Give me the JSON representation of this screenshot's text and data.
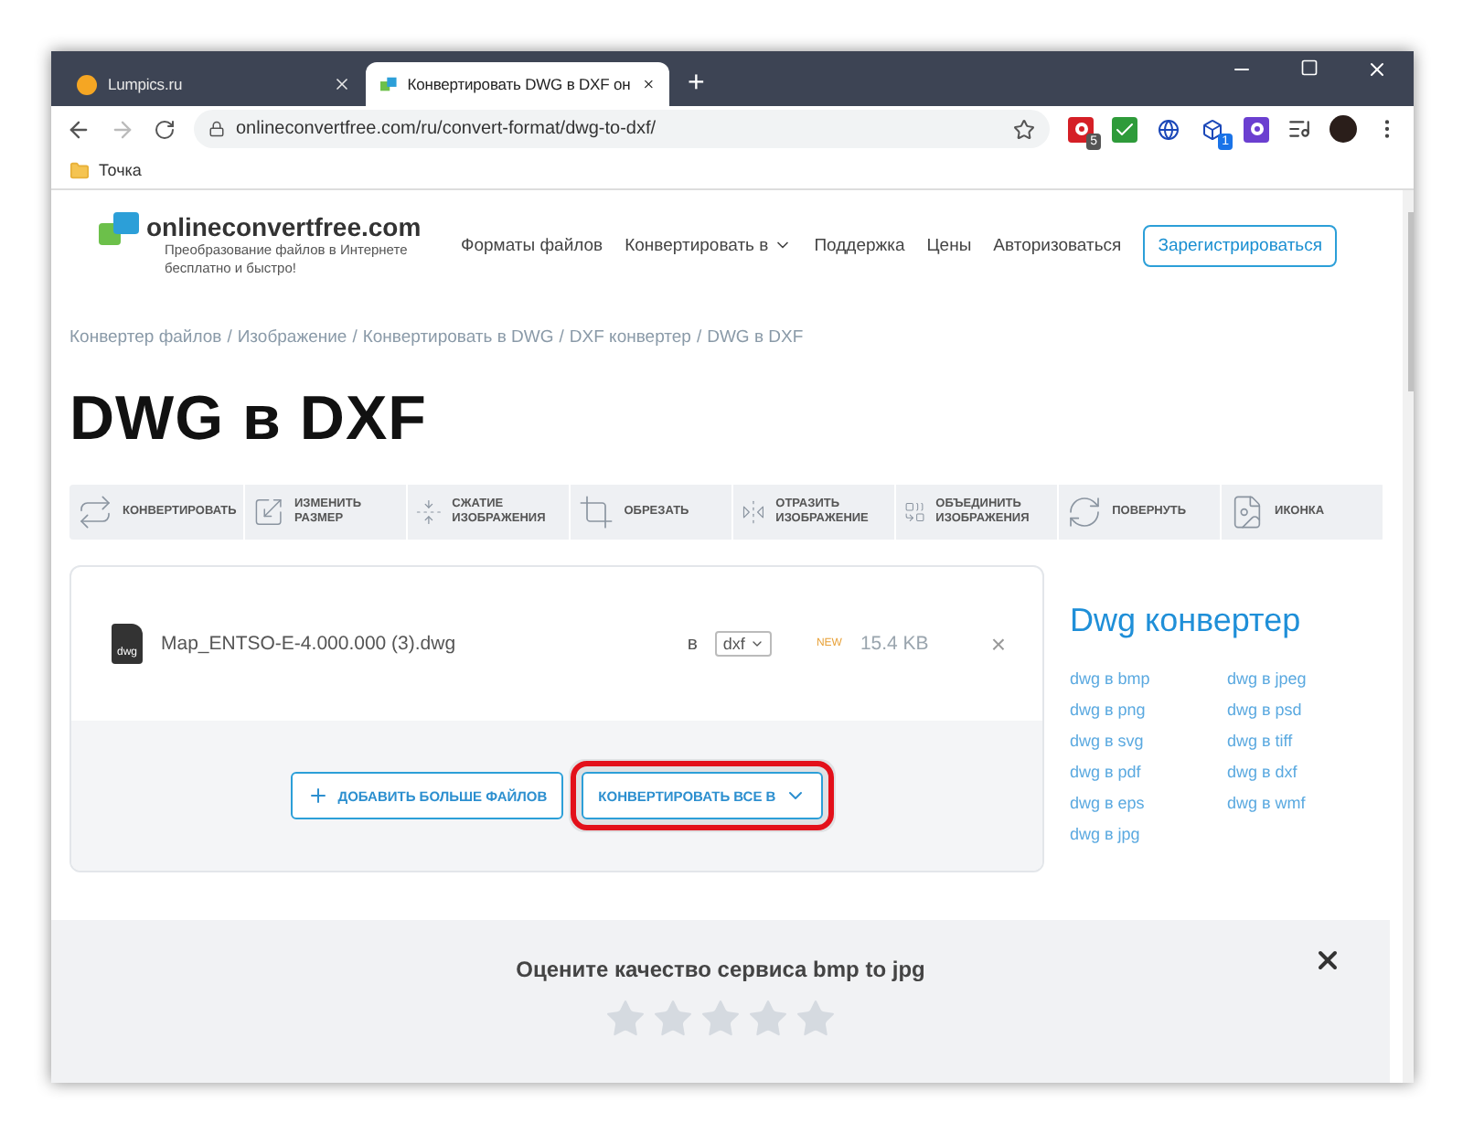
{
  "browser": {
    "tabs": [
      {
        "title": "Lumpics.ru",
        "selected": false
      },
      {
        "title": "Конвертировать DWG в DXF он",
        "selected": true
      }
    ],
    "new_tab": "+",
    "address": "onlineconvertfree.com/ru/convert-format/dwg-to-dxf/",
    "extensions": [
      {
        "kind": "opera",
        "badge": "5"
      },
      {
        "kind": "check"
      },
      {
        "kind": "globe"
      },
      {
        "kind": "cube",
        "badge": "1"
      },
      {
        "kind": "ao"
      }
    ],
    "bookmarks": [
      {
        "label": "Точка"
      }
    ]
  },
  "site": {
    "logo": "onlineconvertfree.com",
    "tagline": "Преобразование файлов в Интернете бесплатно и быстро!",
    "nav": [
      {
        "label": "Форматы файлов",
        "dropdown": false
      },
      {
        "label": "Конвертировать в",
        "dropdown": true
      },
      {
        "label": "Поддержка",
        "dropdown": false
      },
      {
        "label": "Цены",
        "dropdown": false
      },
      {
        "label": "Авторизоваться",
        "dropdown": false
      }
    ],
    "signup": "Зарегистрироваться"
  },
  "breadcrumb": [
    "Конвертер файлов",
    "Изображение",
    "Конвертировать в DWG",
    "DXF конвертер",
    "DWG в DXF"
  ],
  "breadcrumb_separator": "/",
  "heading": "DWG в DXF",
  "tools": [
    {
      "kind": "convert",
      "label": "КОНВЕРТИРОВАТЬ"
    },
    {
      "kind": "resize",
      "label": "ИЗМЕНИТЬ РАЗМЕР"
    },
    {
      "kind": "compress",
      "label": "СЖАТИЕ ИЗОБРАЖЕНИЯ"
    },
    {
      "kind": "crop",
      "label": "ОБРЕЗАТЬ"
    },
    {
      "kind": "flip",
      "label": "ОТРАЗИТЬ ИЗОБРАЖЕНИЕ"
    },
    {
      "kind": "merge",
      "label": "ОБЪЕДИНИТЬ ИЗОБРАЖЕНИЯ"
    },
    {
      "kind": "rotate",
      "label": "ПОВЕРНУТЬ"
    },
    {
      "kind": "icon",
      "label": "ИКОНКА"
    }
  ],
  "file": {
    "badge": "dwg",
    "name": "Map_ENTSO-E-4.000.000 (3).dwg",
    "to": "в",
    "format": "dxf",
    "new": "NEW",
    "size": "15.4 KB",
    "remove": "×"
  },
  "actions": {
    "add": "ДОБАВИТЬ БОЛЬШЕ ФАЙЛОВ",
    "convert_all": "КОНВЕРТИРОВАТЬ ВСЕ В",
    "convert_all_highlighted": true
  },
  "converter": {
    "title": "Dwg конвертер",
    "links": [
      "dwg в bmp",
      "dwg в jpeg",
      "dwg в png",
      "dwg в psd",
      "dwg в svg",
      "dwg в tiff",
      "dwg в pdf",
      "dwg в dxf",
      "dwg в eps",
      "dwg в wmf",
      "dwg в jpg"
    ]
  },
  "rating": {
    "title": "Оцените качество сервиса bmp to jpg",
    "stars": 0
  }
}
